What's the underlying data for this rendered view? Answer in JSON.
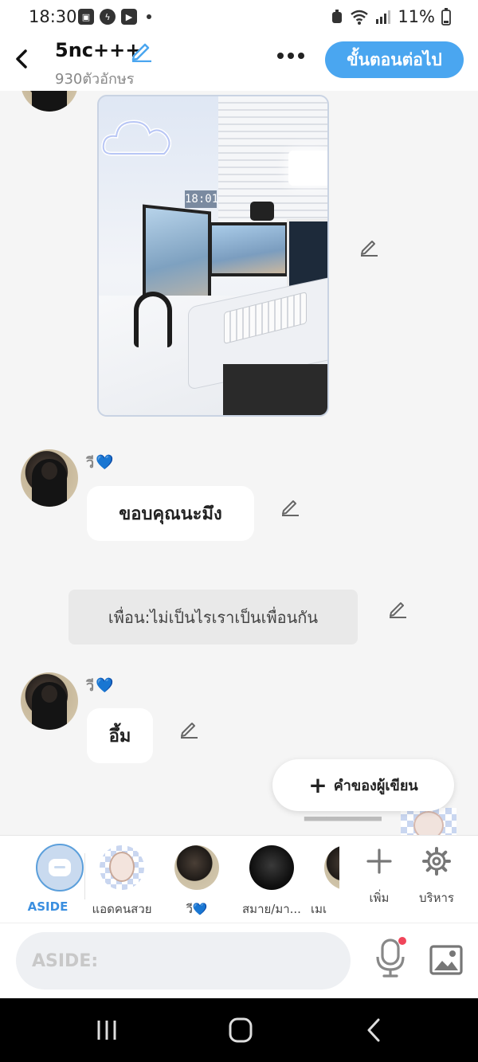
{
  "status_bar": {
    "time": "18:30",
    "battery": "11%"
  },
  "header": {
    "title": "5nc+++",
    "char_count": "930ตัวอักษร",
    "next_label": "ขั้นตอนต่อไป"
  },
  "messages": [
    {
      "type": "image",
      "description_icon": "desk-setup-photo",
      "clock_text": "18:01"
    },
    {
      "type": "character",
      "sender": "วี",
      "sender_emoji": "💙",
      "text": "ขอบคุณนะมึง"
    },
    {
      "type": "narration",
      "text": "เพื่อน:ไม่เป็นไรเราเป็นเพื่อนกัน"
    },
    {
      "type": "character",
      "sender": "วี",
      "sender_emoji": "💙",
      "text": "อึ้ม"
    }
  ],
  "author_button": {
    "label": "คำของผู้เขียน"
  },
  "character_bar": {
    "items": [
      {
        "label": "ASIDE"
      },
      {
        "label": "แอดคนสวย"
      },
      {
        "label": "วี💙"
      },
      {
        "label": "สมาย/มา..."
      },
      {
        "label": "เมเ"
      }
    ],
    "tools": [
      {
        "label": "เพิ่ม",
        "icon": "plus-icon"
      },
      {
        "label": "บริหาร",
        "icon": "gear-icon"
      }
    ]
  },
  "input": {
    "placeholder": "ASIDE:"
  },
  "colors": {
    "accent": "#4aa6f0",
    "notification_dot": "#f0455a"
  }
}
